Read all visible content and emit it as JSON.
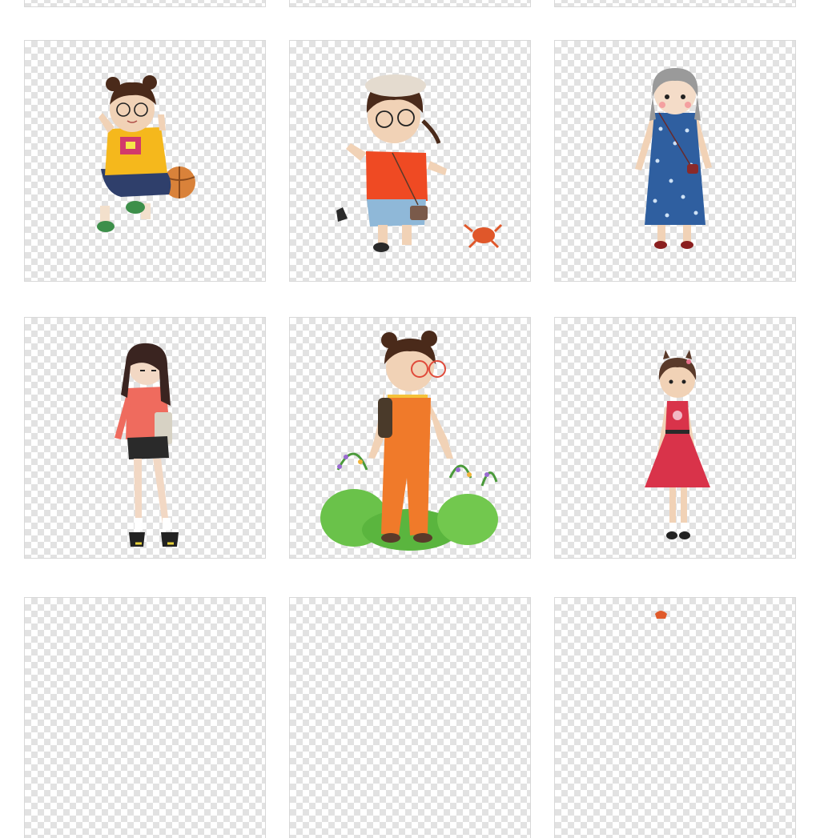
{
  "gallery": {
    "background": "#ffffff",
    "checker_light": "#ffffff",
    "checker_dark": "#e2e2e2",
    "items": [
      {
        "id": "tile-r1c1",
        "subject": "girl-yellow-shirt-basketball-icon"
      },
      {
        "id": "tile-r1c2",
        "subject": "girl-red-shirt-crab-icon"
      },
      {
        "id": "tile-r1c3",
        "subject": "girl-blue-floral-dress-icon"
      },
      {
        "id": "tile-r2c1",
        "subject": "girl-pink-top-tote-bag-icon"
      },
      {
        "id": "tile-r2c2",
        "subject": "girl-orange-overalls-plants-icon"
      },
      {
        "id": "tile-r2c3",
        "subject": "girl-red-dress-icon"
      }
    ]
  }
}
